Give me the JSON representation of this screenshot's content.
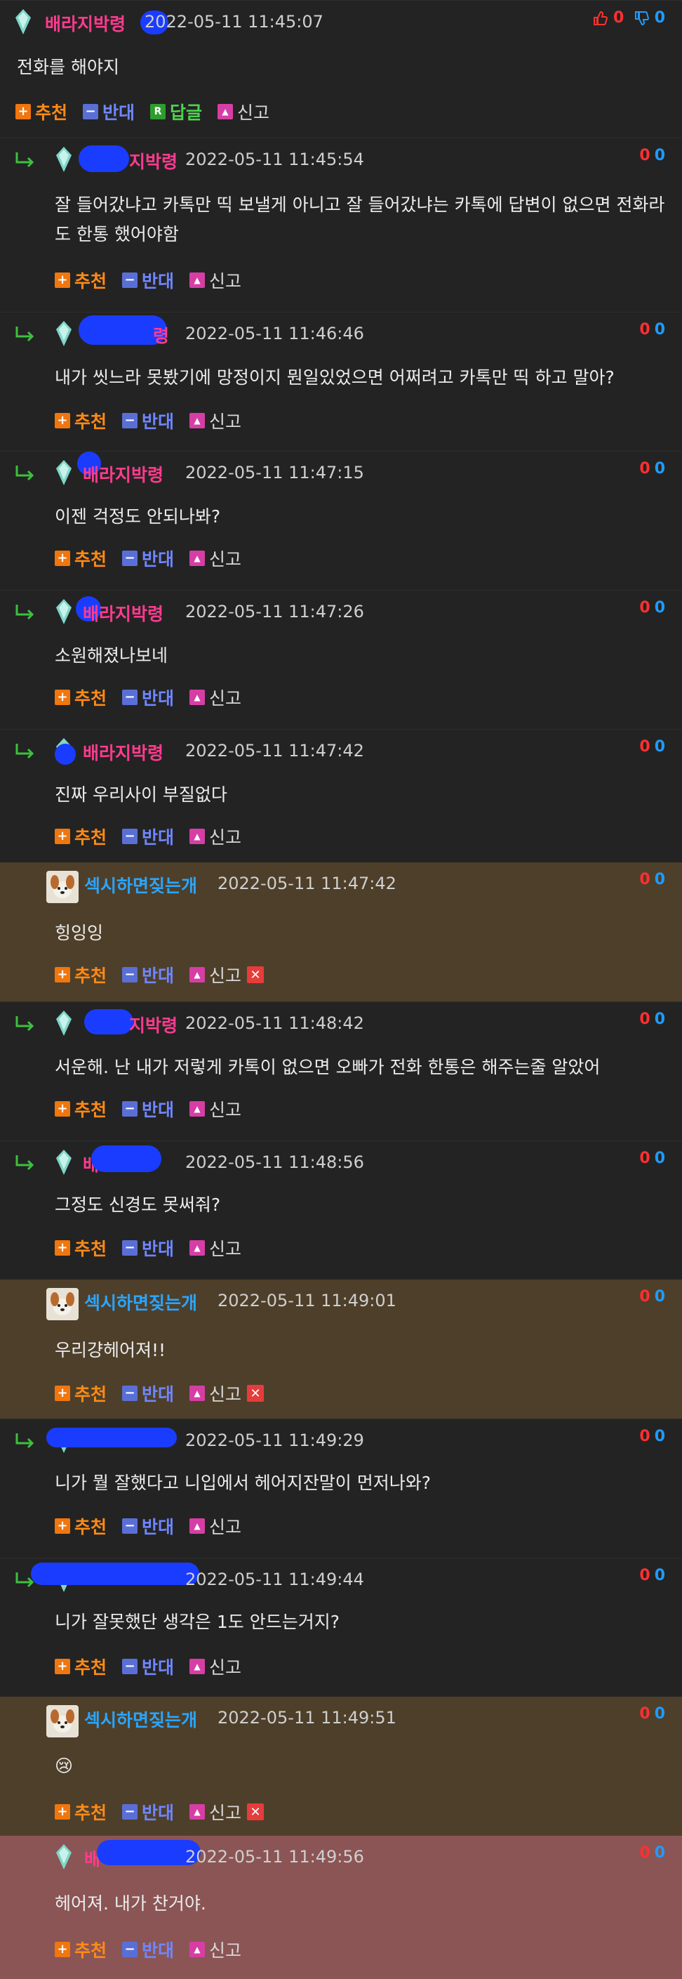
{
  "labels": {
    "recommend": "추천",
    "oppose": "반대",
    "reply": "답글",
    "report": "신고",
    "delete": "✕",
    "reply_arrow": "↳"
  },
  "colors": {
    "recommend": "#ff8a16",
    "oppose": "#6f86ff",
    "reply": "#4fd24f",
    "nick_pink": "#ff3b8e",
    "nick_blue": "#2aa5ff",
    "vote_up": "#ff3030",
    "vote_down": "#1e9bff",
    "highlight_brown": "#4e3f2a",
    "highlight_red": "#8b5555"
  },
  "comments": [
    {
      "nick": "배라지박령",
      "date": "2022-05-11 11:45:07",
      "up": "0",
      "down": "0",
      "text": "전화를 해야지"
    },
    {
      "nick": "지박령",
      "date": "2022-05-11 11:45:54",
      "up": "0",
      "down": "0",
      "text": "잘 들어갔냐고 카톡만 띡 보낼게 아니고 잘 들어갔냐는 카톡에 답변이 없으면 전화라도 한통 했어야함"
    },
    {
      "nick": "령",
      "date": "2022-05-11 11:46:46",
      "up": "0",
      "down": "0",
      "text": "내가 씻느라 못봤기에 망정이지 뭔일있었으면 어쩌려고 카톡만 띡 하고 말아?"
    },
    {
      "nick": "배라지박령",
      "date": "2022-05-11 11:47:15",
      "up": "0",
      "down": "0",
      "text": "이젠 걱정도 안되나봐?"
    },
    {
      "nick": "배라지박령",
      "date": "2022-05-11 11:47:26",
      "up": "0",
      "down": "0",
      "text": "소원해졌나보네"
    },
    {
      "nick": "배라지박령",
      "date": "2022-05-11 11:47:42",
      "up": "0",
      "down": "0",
      "text": "진짜 우리사이 부질없다"
    },
    {
      "nick": "섹시하면짖는개",
      "date": "2022-05-11 11:47:42",
      "up": "0",
      "down": "0",
      "text": "힝잉잉"
    },
    {
      "nick": "지박령",
      "date": "2022-05-11 11:48:42",
      "up": "0",
      "down": "0",
      "text": "서운해. 난 내가 저렇게 카톡이 없으면 오빠가 전화 한통은 해주는줄 알았어"
    },
    {
      "nick": "배",
      "date": "2022-05-11 11:48:56",
      "up": "0",
      "down": "0",
      "text": "그정도 신경도 못써줘?"
    },
    {
      "nick": "섹시하면짖는개",
      "date": "2022-05-11 11:49:01",
      "up": "0",
      "down": "0",
      "text": "우리걍헤어져!!"
    },
    {
      "nick": "",
      "date": "2022-05-11 11:49:29",
      "up": "0",
      "down": "0",
      "text": "니가 뭘 잘했다고 니입에서 헤어지잔말이 먼저나와?"
    },
    {
      "nick": "",
      "date": "2022-05-11 11:49:44",
      "up": "0",
      "down": "0",
      "text": "니가 잘못했단 생각은 1도 안드는거지?"
    },
    {
      "nick": "섹시하면짖는개",
      "date": "2022-05-11 11:49:51",
      "up": "0",
      "down": "0",
      "text": "😢"
    },
    {
      "nick": "배",
      "date": "2022-05-11 11:49:56",
      "up": "0",
      "down": "0",
      "text": "헤어져. 내가 찬거야."
    }
  ]
}
